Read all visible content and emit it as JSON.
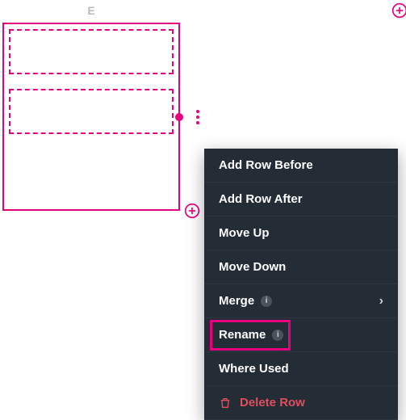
{
  "grid": {
    "column_label": "E"
  },
  "menu": {
    "add_before": "Add Row Before",
    "add_after": "Add Row After",
    "move_up": "Move Up",
    "move_down": "Move Down",
    "merge": "Merge",
    "rename": "Rename",
    "where_used": "Where Used",
    "delete_row": "Delete Row",
    "info_glyph": "i",
    "chevron": "›"
  }
}
